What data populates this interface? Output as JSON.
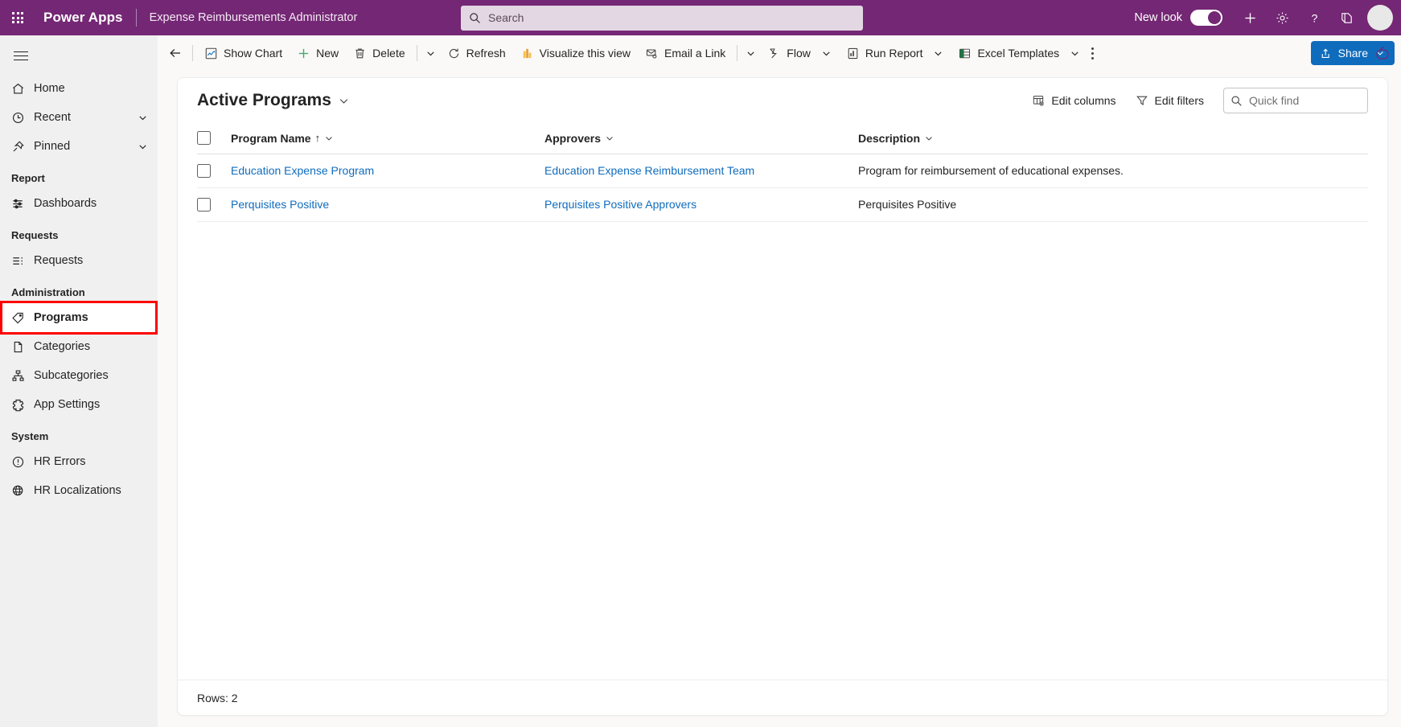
{
  "topbar": {
    "waffle_icon": "app-launcher-icon",
    "brand": "Power Apps",
    "app_name": "Expense Reimbursements Administrator",
    "search": {
      "placeholder": "Search",
      "value": "",
      "icon": "search-icon"
    },
    "new_look_label": "New look",
    "new_look_enabled": true,
    "icons": [
      "plus-icon",
      "gear-icon",
      "question-icon",
      "feedback-icon",
      "avatar"
    ],
    "background_color": "#742774"
  },
  "sidebar": {
    "hamburger_icon": "hamburger-icon",
    "items": [
      {
        "label": "Home",
        "icon": "home-icon",
        "chevron": false,
        "group": null
      },
      {
        "label": "Recent",
        "icon": "clock-icon",
        "chevron": true,
        "group": null
      },
      {
        "label": "Pinned",
        "icon": "pin-icon",
        "chevron": true,
        "group": null
      }
    ],
    "groups": [
      {
        "title": "Report",
        "items": [
          {
            "label": "Dashboards",
            "icon": "dashboards-icon"
          }
        ]
      },
      {
        "title": "Requests",
        "items": [
          {
            "label": "Requests",
            "icon": "list-icon"
          }
        ]
      },
      {
        "title": "Administration",
        "items": [
          {
            "label": "Programs",
            "icon": "tag-icon",
            "selected": true,
            "highlighted": true
          },
          {
            "label": "Categories",
            "icon": "document-icon"
          },
          {
            "label": "Subcategories",
            "icon": "hierarchy-icon"
          },
          {
            "label": "App Settings",
            "icon": "settings-gear-icon"
          }
        ]
      },
      {
        "title": "System",
        "items": [
          {
            "label": "HR Errors",
            "icon": "error-circle-icon"
          },
          {
            "label": "HR Localizations",
            "icon": "globe-icon"
          }
        ]
      }
    ],
    "highlight_color": "#ff0000",
    "selected_indicator_color": "#0f6cbd"
  },
  "commandbar": {
    "back_icon": "back-arrow-icon",
    "commands": [
      {
        "label": "Show Chart",
        "icon": "show-chart-icon"
      },
      {
        "label": "New",
        "icon": "plus-icon"
      },
      {
        "label": "Delete",
        "icon": "trash-icon"
      },
      {
        "label": "",
        "icon": "chevron-down-icon",
        "caret_only": true
      },
      {
        "label": "Refresh",
        "icon": "refresh-icon"
      },
      {
        "label": "Visualize this view",
        "icon": "visualize-icon"
      },
      {
        "label": "Email a Link",
        "icon": "email-link-icon"
      },
      {
        "label": "",
        "icon": "chevron-down-icon",
        "caret_only": true
      },
      {
        "label": "Flow",
        "icon": "flow-icon",
        "has_caret": true
      },
      {
        "label": "Run Report",
        "icon": "run-report-icon",
        "has_caret": true
      },
      {
        "label": "Excel Templates",
        "icon": "excel-icon",
        "has_caret": true
      }
    ],
    "overflow_icon": "kebab-menu-icon",
    "share": {
      "label": "Share",
      "icon": "share-icon",
      "color": "#0f6cbd"
    }
  },
  "grid": {
    "view_title": "Active Programs",
    "view_title_chevron": "chevron-down-icon",
    "edit_columns": {
      "label": "Edit columns",
      "icon": "edit-columns-icon"
    },
    "edit_filters": {
      "label": "Edit filters",
      "icon": "filter-icon"
    },
    "quick_find": {
      "placeholder": "Quick find",
      "value": "",
      "icon": "search-icon"
    },
    "columns": [
      {
        "label": "Program Name",
        "sorted": true,
        "sort_direction": "↑"
      },
      {
        "label": "Approvers",
        "sorted": false
      },
      {
        "label": "Description",
        "sorted": false
      }
    ],
    "rows": [
      {
        "program_name": "Education Expense Program",
        "approvers": "Education Expense Reimbursement Team",
        "description": "Program for reimbursement of educational expenses."
      },
      {
        "program_name": "Perquisites Positive",
        "approvers": "Perquisites Positive Approvers",
        "description": "Perquisites Positive"
      }
    ],
    "footer_rows_label": "Rows: 2",
    "link_color": "#0f6cbd"
  },
  "rightrail": {
    "icon": "copilot-icon"
  }
}
